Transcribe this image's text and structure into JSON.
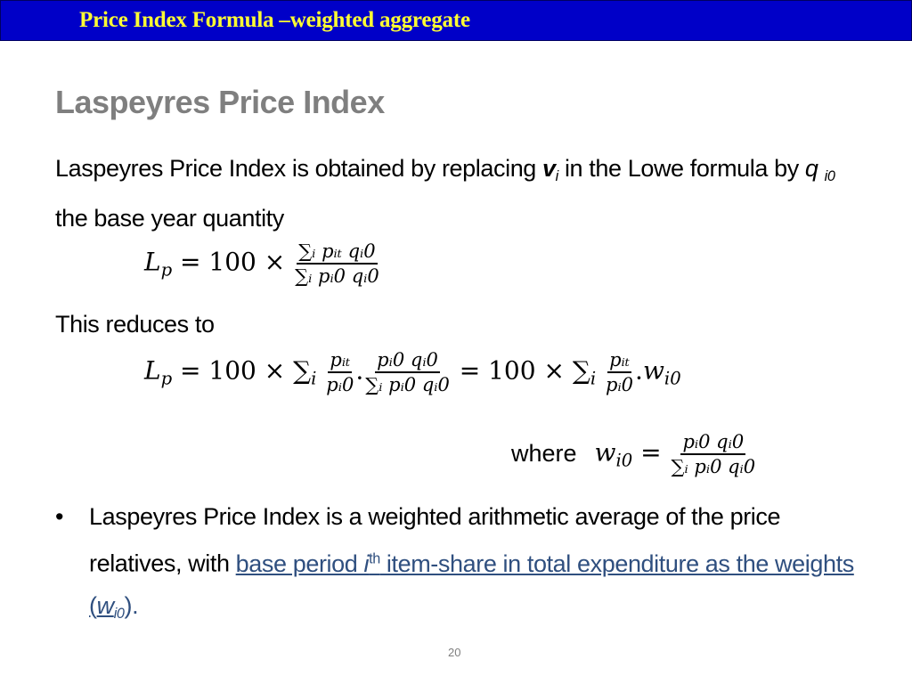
{
  "banner": {
    "title": "Price Index Formula –weighted aggregate"
  },
  "slide": {
    "title": "Laspeyres Price Index",
    "intro": {
      "part1": "Laspeyres Price Index is obtained by replacing ",
      "var_v": "v",
      "var_v_sub": "i",
      "part2": " in the Lowe formula by ",
      "var_q": "q",
      "var_q_sub": "i0",
      "part3": " the base year quantity"
    },
    "reduces_text": "This reduces to",
    "where_label": "where",
    "bullet": {
      "marker": "•",
      "text_plain": "Laspeyres Price Index is a weighted arithmetic average of the price relatives, with ",
      "link_part1": "base period ",
      "link_i": "i",
      "link_th": "th",
      "link_part2": " item-share in total expenditure as the weights (",
      "link_w": "w",
      "link_w_sub": "i0",
      "tail": ")."
    },
    "page_number": "20"
  },
  "equations": {
    "eq1": {
      "lhs": "L",
      "lhs_sub": "p",
      "eq": " = 100 × ",
      "num": "∑ᵢ pᵢₜ qᵢ0",
      "den": "∑ᵢ pᵢ0 qᵢ0"
    },
    "eq2": {
      "lhs": "L",
      "lhs_sub": "p",
      "eq": " = 100 × ∑",
      "sum_sub": "i",
      "f1_num": "pᵢₜ",
      "f1_den": "pᵢ0",
      "dot": ".",
      "f2_num": "pᵢ0 qᵢ0",
      "f2_den": "∑ᵢ pᵢ0 qᵢ0",
      "eq_mid": " = 100 × ∑",
      "f3_num": "pᵢₜ",
      "f3_den": "pᵢ0",
      "w": "w",
      "w_sub": "i0"
    },
    "eq3": {
      "w": "w",
      "w_sub": "i0",
      "eq": " = ",
      "num": "pᵢ0 qᵢ0",
      "den": "∑ᵢ pᵢ0 qᵢ0"
    }
  }
}
